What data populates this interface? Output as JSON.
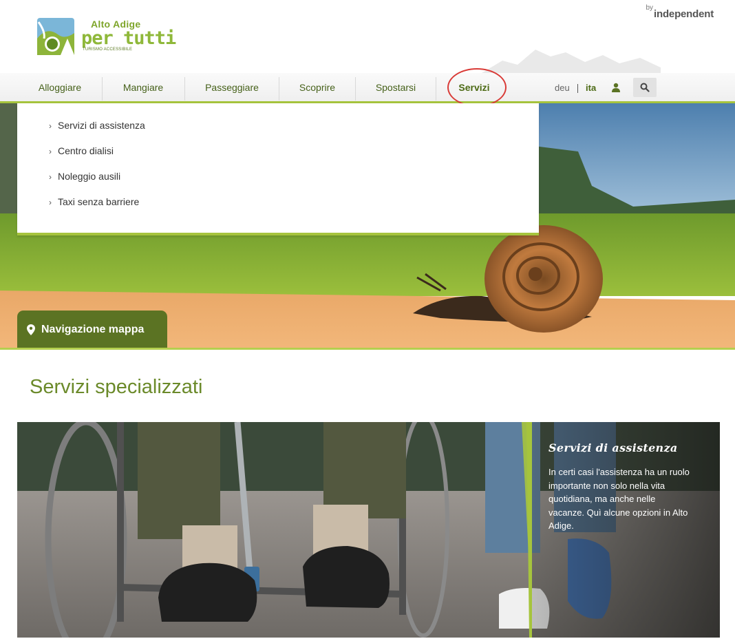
{
  "header": {
    "logo": {
      "line1": "Alto Adige",
      "line2": "per tutti",
      "line3": "TURISMO ACCESSIBILE"
    },
    "byline": {
      "by": "by",
      "brand": "independent"
    }
  },
  "nav": {
    "items": [
      {
        "label": "Alloggiare"
      },
      {
        "label": "Mangiare"
      },
      {
        "label": "Passeggiare"
      },
      {
        "label": "Scoprire"
      },
      {
        "label": "Spostarsi"
      },
      {
        "label": "Servizi"
      }
    ],
    "active": "Servizi",
    "languages": [
      {
        "label": "deu"
      },
      {
        "label": "ita"
      }
    ],
    "active_language": "ita",
    "icons": {
      "user": "user-icon",
      "search": "search-icon"
    }
  },
  "dropdown": {
    "items": [
      {
        "label": "Servizi di assistenza"
      },
      {
        "label": "Centro dialisi"
      },
      {
        "label": "Noleggio ausili"
      },
      {
        "label": "Taxi senza barriere"
      }
    ]
  },
  "map_button": {
    "label": "Navigazione mappa",
    "icon": "map-pin-icon"
  },
  "section": {
    "title": "Servizi specializzati",
    "card": {
      "title": "Servizi di assistenza",
      "description": "In certi casi l'assistenza ha un ruolo importante non solo nella vita quotidiana, ma anche nelle vacanze. Quì alcune opzioni in Alto Adige."
    }
  },
  "colors": {
    "brand_green": "#a6c43d",
    "dark_green": "#5b7323",
    "title_green": "#6b8a2a",
    "highlight_circle": "#d93a36"
  }
}
